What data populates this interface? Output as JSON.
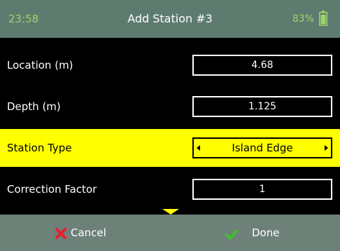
{
  "status_bar": {
    "time": "23:58",
    "title": "Add Station #3",
    "battery": "83%",
    "battery_icon": "battery-icon"
  },
  "rows": [
    {
      "label": "Location (m)",
      "value": "4.68"
    },
    {
      "label": "Depth (m)",
      "value": "1.125"
    },
    {
      "label": "Station Type",
      "value": "Island Edge",
      "selected": true
    },
    {
      "label": "Correction Factor",
      "value": "1"
    }
  ],
  "footer": {
    "cancel_label": "Cancel",
    "done_label": "Done",
    "cancel_icon": "x-icon",
    "done_icon": "checkmark-icon"
  },
  "colors": {
    "header_bg": "#5e7b6f",
    "accent_green": "#9fd36a",
    "selected_row": "#ffff00",
    "footer_bg": "#6e8179",
    "cancel_red": "#e8202a",
    "done_green": "#3fbf2a"
  }
}
